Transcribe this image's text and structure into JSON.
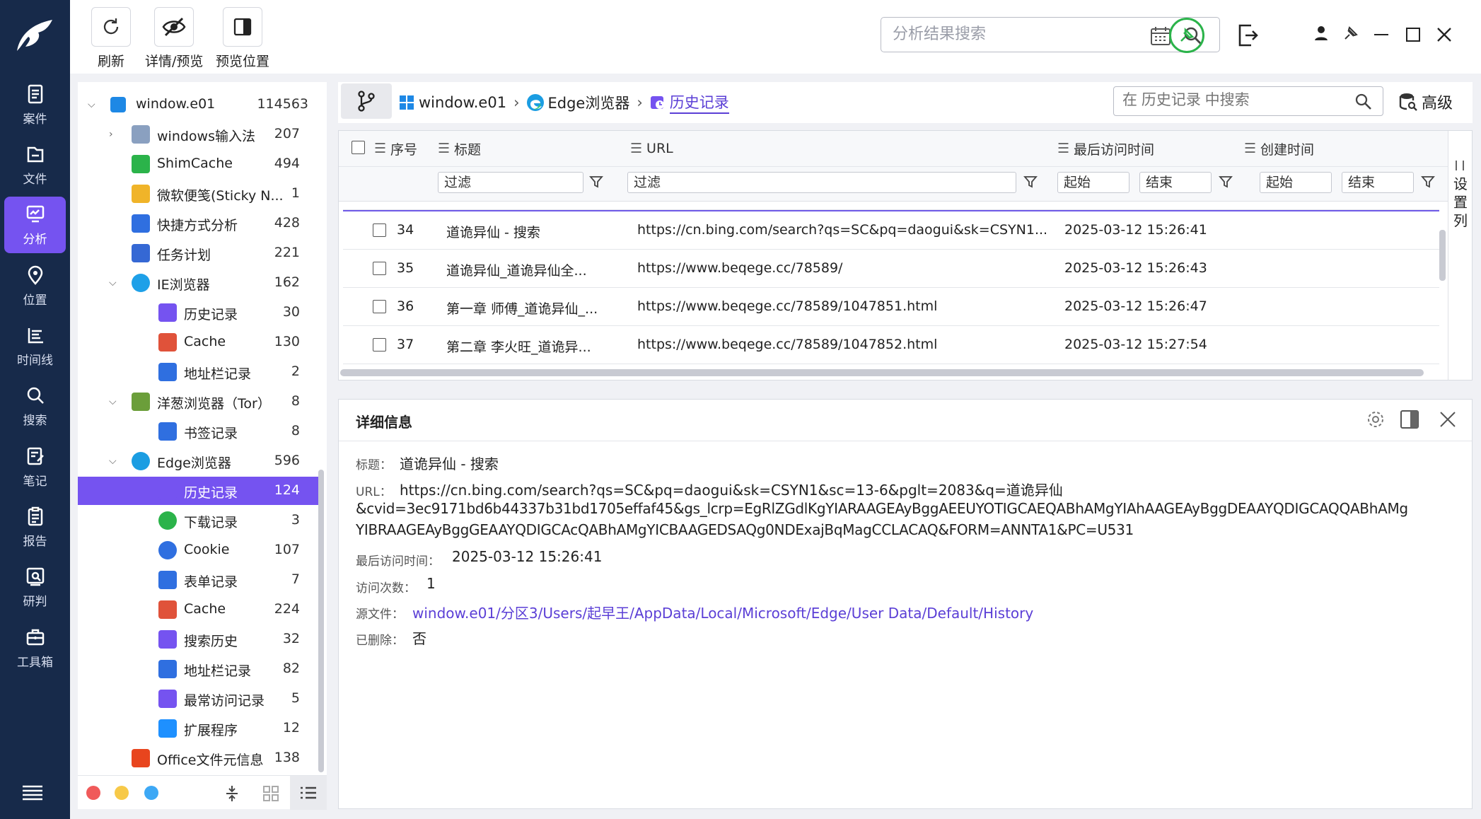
{
  "toolbar": {
    "refresh": "刷新",
    "detail_preview": "详情/预览",
    "preview_position": "预览位置",
    "search_placeholder": "分析结果搜索"
  },
  "rail": {
    "items": [
      {
        "label": "案件",
        "icon": "briefcase-doc-icon"
      },
      {
        "label": "文件",
        "icon": "folder-icon"
      },
      {
        "label": "分析",
        "icon": "monitor-chart-icon",
        "active": true
      },
      {
        "label": "位置",
        "icon": "location-pin-icon"
      },
      {
        "label": "时间线",
        "icon": "timeline-icon"
      },
      {
        "label": "搜索",
        "icon": "search-icon"
      },
      {
        "label": "笔记",
        "icon": "note-icon"
      },
      {
        "label": "报告",
        "icon": "report-icon"
      },
      {
        "label": "研判",
        "icon": "analyze-icon"
      },
      {
        "label": "工具箱",
        "icon": "toolbox-icon"
      }
    ]
  },
  "tree": {
    "nodes": [
      {
        "label": "window.e01",
        "count": "114563"
      },
      {
        "label": "windows输入法",
        "count": "207"
      },
      {
        "label": "ShimCache",
        "count": "494"
      },
      {
        "label": "微软便笺(Sticky N...",
        "count": "1"
      },
      {
        "label": "快捷方式分析",
        "count": "428"
      },
      {
        "label": "任务计划",
        "count": "221"
      },
      {
        "label": "IE浏览器",
        "count": "162"
      },
      {
        "label": "历史记录",
        "count": "30"
      },
      {
        "label": "Cache",
        "count": "130"
      },
      {
        "label": "地址栏记录",
        "count": "2"
      },
      {
        "label": "洋葱浏览器（Tor）",
        "count": "8"
      },
      {
        "label": "书签记录",
        "count": "8"
      },
      {
        "label": "Edge浏览器",
        "count": "596"
      },
      {
        "label": "历史记录",
        "count": "124"
      },
      {
        "label": "下载记录",
        "count": "3"
      },
      {
        "label": "Cookie",
        "count": "107"
      },
      {
        "label": "表单记录",
        "count": "7"
      },
      {
        "label": "Cache",
        "count": "224"
      },
      {
        "label": "搜索历史",
        "count": "32"
      },
      {
        "label": "地址栏记录",
        "count": "82"
      },
      {
        "label": "最常访问记录",
        "count": "5"
      },
      {
        "label": "扩展程序",
        "count": "12"
      },
      {
        "label": "Office文件元信息",
        "count": "138"
      }
    ]
  },
  "breadcrumb": {
    "items": [
      "window.e01",
      "Edge浏览器",
      "历史记录"
    ],
    "search_placeholder": "在 历史记录 中搜索",
    "advanced": "高级"
  },
  "grid": {
    "headers": {
      "seq": "序号",
      "title": "标题",
      "url": "URL",
      "last_visit": "最后访问时间",
      "created": "创建时间"
    },
    "filter": "过滤",
    "start": "起始",
    "end": "结束",
    "settings_col": [
      "设",
      "置",
      "列"
    ],
    "rows": [
      {
        "seq": "34",
        "title": "道诡异仙 - 搜索",
        "url": "https://cn.bing.com/search?qs=SC&pq=daogui&sk=CSYN1...",
        "last_visit": "2025-03-12 15:26:41"
      },
      {
        "seq": "35",
        "title": "道诡异仙_道诡异仙全...",
        "url": "https://www.beqege.cc/78589/",
        "last_visit": "2025-03-12 15:26:43"
      },
      {
        "seq": "36",
        "title": "第一章 师傅_道诡异仙_...",
        "url": "https://www.beqege.cc/78589/1047851.html",
        "last_visit": "2025-03-12 15:26:47"
      },
      {
        "seq": "37",
        "title": "第二章 李火旺_道诡异...",
        "url": "https://www.beqege.cc/78589/1047852.html",
        "last_visit": "2025-03-12 15:27:54"
      }
    ]
  },
  "detail": {
    "heading": "详细信息",
    "title_label": "标题：",
    "title_value": "道诡异仙 - 搜索",
    "url_label": "URL：",
    "url_line1": "https://cn.bing.com/search?qs=SC&pq=daogui&sk=CSYN1&sc=13-6&pglt=2083&q=道诡异仙",
    "url_line2": "&cvid=3ec9171bd6b44337b31bd1705effaf45&gs_lcrp=EgRlZGdlKgYIARAAGEAyBggAEEUYOTIGCAEQABhAMgYIAhAAGEAyBggDEAAYQDIGCAQQABhAMg",
    "url_line3": "YIBRAAGEAyBggGEAAYQDIGCAcQABhAMgYICBAAGEDSAQg0NDExajBqMagCCLACAQ&FORM=ANNTA1&PC=U531",
    "last_visit_label": "最后访问时间：",
    "last_visit_value": "2025-03-12 15:26:41",
    "visit_count_label": "访问次数：",
    "visit_count_value": "1",
    "source_label": "源文件：",
    "source_value": "window.e01/分区3/Users/起早王/AppData/Local/Microsoft/Edge/User Data/Default/History",
    "deleted_label": "已删除：",
    "deleted_value": "否"
  },
  "colors": {
    "accent": "#7553f0",
    "rail": "#172a4a",
    "green": "#2bb34a"
  }
}
